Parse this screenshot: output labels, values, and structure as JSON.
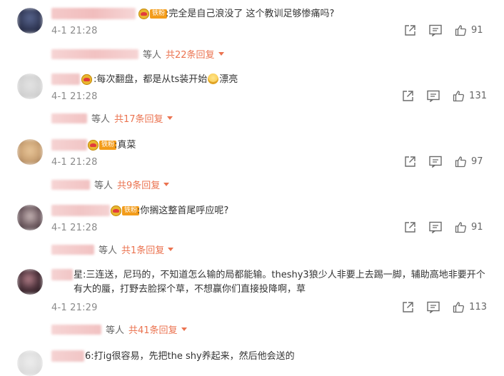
{
  "comments": [
    {
      "text": ":完全是自己浪没了 这个教训足够惨痛吗?",
      "fan_tag": "铁粉",
      "time": "4-1 21:28",
      "likes": "91",
      "replies_suffix": "等人",
      "replies_count": "共22条回复"
    },
    {
      "text_a": ":每次翻盘，都是从ts装开始",
      "text_b": "漂亮",
      "time": "4-1 21:28",
      "likes": "131",
      "replies_suffix": "等人",
      "replies_count": "共17条回复"
    },
    {
      "text": ":真菜",
      "fan_tag": "铁粉",
      "time": "4-1 21:28",
      "likes": "97",
      "replies_suffix": "等人",
      "replies_count": "共9条回复"
    },
    {
      "text": ":你搁这整首尾呼应呢?",
      "fan_tag": "铁粉",
      "time": "4-1 21:28",
      "likes": "91",
      "replies_suffix": "等人",
      "replies_count": "共1条回复"
    },
    {
      "text": "星:三连送，尼玛的，不知道怎么输的局都能输。theshy3狼少人非要上去踢一脚，辅助高地非要开个有大的蜃，打野去脸探个草，不想赢你们直接投降啊，草",
      "time": "4-1 21:29",
      "likes": "113",
      "replies_suffix": "等人",
      "replies_count": "共41条回复"
    },
    {
      "text": "6:打ig很容易，先把the shy养起来，然后他会送的"
    }
  ],
  "icons": {
    "share": "share-icon",
    "comment": "comment-icon",
    "like": "thumbs-up-icon",
    "caret": "caret-down-icon"
  },
  "colors": {
    "accent": "#eb7350",
    "muted": "#8a8a8a",
    "fan_tag": "#f39c1a"
  }
}
